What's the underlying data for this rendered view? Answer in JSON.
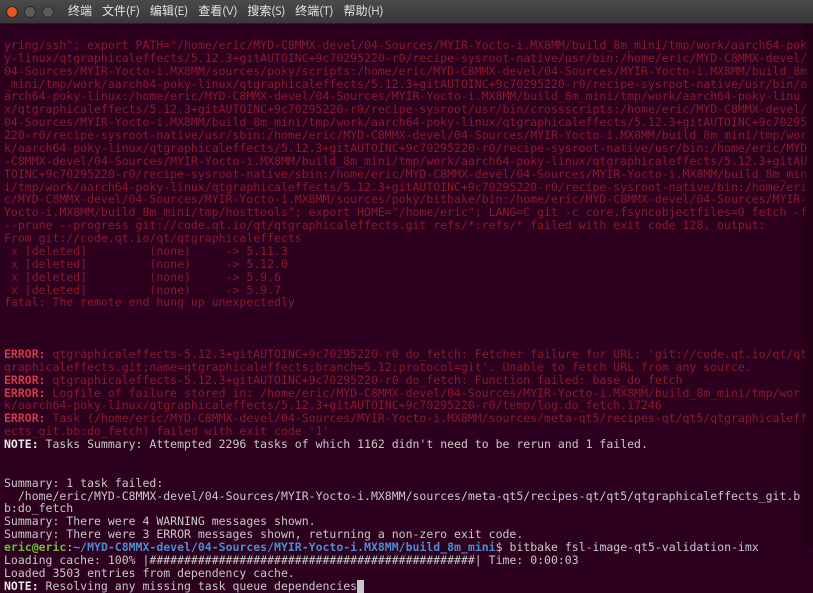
{
  "menu": {
    "terminal": "终端",
    "file": "文件(F)",
    "edit": "编辑(E)",
    "view": "查看(V)",
    "search": "搜索(S)",
    "terminal_tab": "终端(T)",
    "help": "帮助(H)"
  },
  "scrollback_block": "yring/ssh\"; export PATH=\"/home/eric/MYD-C8MMX-devel/04-Sources/MYIR-Yocto-i.MX8MM/build_8m_mini/tmp/work/aarch64-poky-linux/qtgraphicaleffects/5.12.3+gitAUTOINC+9c70295220-r0/recipe-sysroot-native/usr/bin:/home/eric/MYD-C8MMX-devel/04-Sources/MYIR-Yocto-i.MX8MM/sources/poky/scripts:/home/eric/MYD-C8MMX-devel/04-Sources/MYIR-Yocto-i.MX8MM/build_8m_mini/tmp/work/aarch64-poky-linux/qtgraphicaleffects/5.12.3+gitAUTOINC+9c70295220-r0/recipe-sysroot-native/usr/bin/aarch64-poky-linux:/home/eric/MYD-C8MMX-devel/04-Sources/MYIR-Yocto-i.MX8MM/build_8m_mini/tmp/work/aarch64-poky-linux/qtgraphicaleffects/5.12.3+gitAUTOINC+9c70295220-r0/recipe-sysroot/usr/bin/crossscripts:/home/eric/MYD-C8MMX-devel/04-Sources/MYIR-Yocto-i.MX8MM/build_8m_mini/tmp/work/aarch64-poky-linux/qtgraphicaleffects/5.12.3+gitAUTOINC+9c70295220-r0/recipe-sysroot-native/usr/sbin:/home/eric/MYD-C8MMX-devel/04-Sources/MYIR-Yocto-i.MX8MM/build_8m_mini/tmp/work/aarch64-poky-linux/qtgraphicaleffects/5.12.3+gitAUTOINC+9c70295220-r0/recipe-sysroot-native/usr/bin:/home/eric/MYD-C8MMX-devel/04-Sources/MYIR-Yocto-i.MX8MM/build_8m_mini/tmp/work/aarch64-poky-linux/qtgraphicaleffects/5.12.3+gitAUTOINC+9c70295220-r0/recipe-sysroot-native/sbin:/home/eric/MYD-C8MMX-devel/04-Sources/MYIR-Yocto-i.MX8MM/build_8m_mini/tmp/work/aarch64-poky-linux/qtgraphicaleffects/5.12.3+gitAUTOINC+9c70295220-r0/recipe-sysroot-native/bin:/home/eric/MYD-C8MMX-devel/04-Sources/MYIR-Yocto-i.MX8MM/sources/poky/bitbake/bin:/home/eric/MYD-C8MMX-devel/04-Sources/MYIR-Yocto-i.MX8MM/build_8m_mini/tmp/hosttools\"; export HOME=\"/home/eric\"; LANG=C git -c core.fsyncobjectfiles=0 fetch -f --prune --progress git://code.qt.io/qt/qtgraphicaleffects.git refs/*:refs/* failed with exit code 128, output:\nFrom git://code.qt.io/qt/qtgraphicaleffects\n x [deleted]         (none)     -> 5.11.3\n x [deleted]         (none)     -> 5.12.0\n x [deleted]         (none)     -> 5.9.6\n x [deleted]         (none)     -> 5.9.7\nfatal: The remote end hung up unexpectedly\n",
  "errors": {
    "e1_prefix": "ERROR: ",
    "e1_body": "qtgraphicaleffects-5.12.3+gitAUTOINC+9c70295220-r0 do_fetch: Fetcher failure for URL: 'git://code.qt.io/qt/qtgraphicaleffects.git;name=qtgraphicaleffects;branch=5.12;protocol=git'. Unable to fetch URL from any source.",
    "e2_prefix": "ERROR: ",
    "e2_body": "qtgraphicaleffects-5.12.3+gitAUTOINC+9c70295220-r0 do_fetch: Function failed: base_do_fetch",
    "e3_prefix": "ERROR: ",
    "e3_body": "Logfile of failure stored in: /home/eric/MYD-C8MMX-devel/04-Sources/MYIR-Yocto-i.MX8MM/build_8m_mini/tmp/work/aarch64-poky-linux/qtgraphicaleffects/5.12.3+gitAUTOINC+9c70295220-r0/temp/log.do_fetch.17246",
    "e4_prefix": "ERROR: ",
    "e4_body": "Task (/home/eric/MYD-C8MMX-devel/04-Sources/MYIR-Yocto-i.MX8MM/sources/meta-qt5/recipes-qt/qt5/qtgraphicaleffects_git.bb:do_fetch) failed with exit code '1'"
  },
  "note": {
    "prefix": "NOTE: ",
    "body": "Tasks Summary: Attempted 2296 tasks of which 1162 didn't need to be rerun and 1 failed."
  },
  "summary": {
    "l1": "Summary: 1 task failed:",
    "l2": "  /home/eric/MYD-C8MMX-devel/04-Sources/MYIR-Yocto-i.MX8MM/sources/meta-qt5/recipes-qt/qt5/qtgraphicaleffects_git.bb:do_fetch",
    "l3": "Summary: There were 4 WARNING messages shown.",
    "l4": "Summary: There were 3 ERROR messages shown, returning a non-zero exit code."
  },
  "prompt": {
    "user_host": "eric@eric",
    "sep": ":",
    "path": "~/MYD-C8MMX-devel/04-Sources/MYIR-Yocto-i.MX8MM/build_8m_mini",
    "dollar": "$ ",
    "command": "bitbake fsl-image-qt5-validation-imx"
  },
  "loading": {
    "line1": "Loading cache: 100% |###############################################| Time: 0:00:03",
    "line2": "Loaded 3503 entries from dependency cache."
  },
  "note2": {
    "prefix": "NOTE: ",
    "body": "Resolving any missing task queue dependencies"
  }
}
